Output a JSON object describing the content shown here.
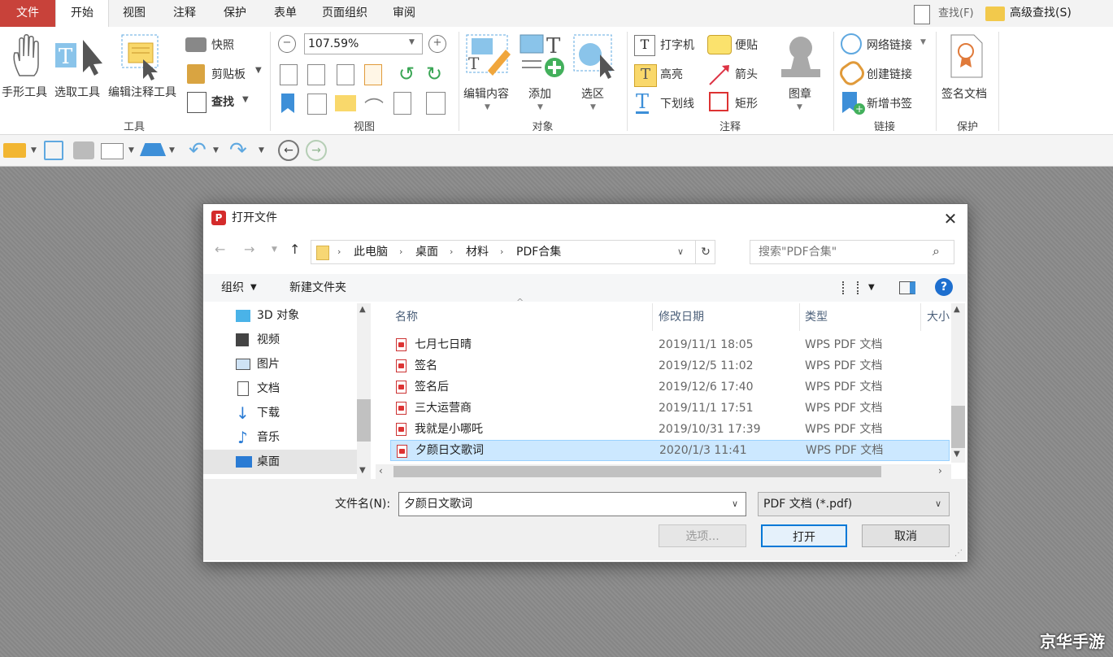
{
  "menu": {
    "tabs": [
      "文件",
      "开始",
      "视图",
      "注释",
      "保护",
      "表单",
      "页面组织",
      "审阅"
    ],
    "find": "查找(F)",
    "advanced_find": "高级查找(S)"
  },
  "ribbon": {
    "tools": {
      "hand": "手形工具",
      "select": "选取工具",
      "edit_annot": "编辑注释工具",
      "snapshot": "快照",
      "clipboard": "剪贴板",
      "find": "查找",
      "group": "工具"
    },
    "view": {
      "zoom": "107.59%",
      "group": "视图"
    },
    "objects": {
      "edit_content": "编辑内容",
      "add": "添加",
      "select_area": "选区",
      "group": "对象"
    },
    "annot": {
      "typewriter": "打字机",
      "note": "便贴",
      "highlight": "高亮",
      "arrow": "箭头",
      "underline": "下划线",
      "rect": "矩形",
      "stamp": "图章",
      "group": "注释"
    },
    "links": {
      "web_link": "网络链接",
      "create_link": "创建链接",
      "add_bookmark": "新增书签",
      "group": "链接"
    },
    "protect": {
      "sign_doc": "签名文档",
      "group": "保护"
    }
  },
  "dialog": {
    "title": "打开文件",
    "breadcrumb": [
      "此电脑",
      "桌面",
      "材料",
      "PDF合集"
    ],
    "search_placeholder": "搜索\"PDF合集\"",
    "organize": "组织",
    "new_folder": "新建文件夹",
    "nav": [
      "3D 对象",
      "视频",
      "图片",
      "文档",
      "下载",
      "音乐",
      "桌面"
    ],
    "columns": {
      "name": "名称",
      "date": "修改日期",
      "type": "类型",
      "size": "大小"
    },
    "files": [
      {
        "name": "七月七日晴",
        "date": "2019/11/1 18:05",
        "type": "WPS PDF 文档"
      },
      {
        "name": "签名",
        "date": "2019/12/5 11:02",
        "type": "WPS PDF 文档"
      },
      {
        "name": "签名后",
        "date": "2019/12/6 17:40",
        "type": "WPS PDF 文档"
      },
      {
        "name": "三大运营商",
        "date": "2019/11/1 17:51",
        "type": "WPS PDF 文档"
      },
      {
        "name": "我就是小哪吒",
        "date": "2019/10/31 17:39",
        "type": "WPS PDF 文档"
      },
      {
        "name": "夕颜日文歌词",
        "date": "2020/1/3 11:41",
        "type": "WPS PDF 文档"
      }
    ],
    "filename_label": "文件名(N):",
    "filename_value": "夕颜日文歌词",
    "filetype": "PDF 文档 (*.pdf)",
    "options_btn": "选项...",
    "open_btn": "打开",
    "cancel_btn": "取消"
  },
  "watermark": "京华手游"
}
